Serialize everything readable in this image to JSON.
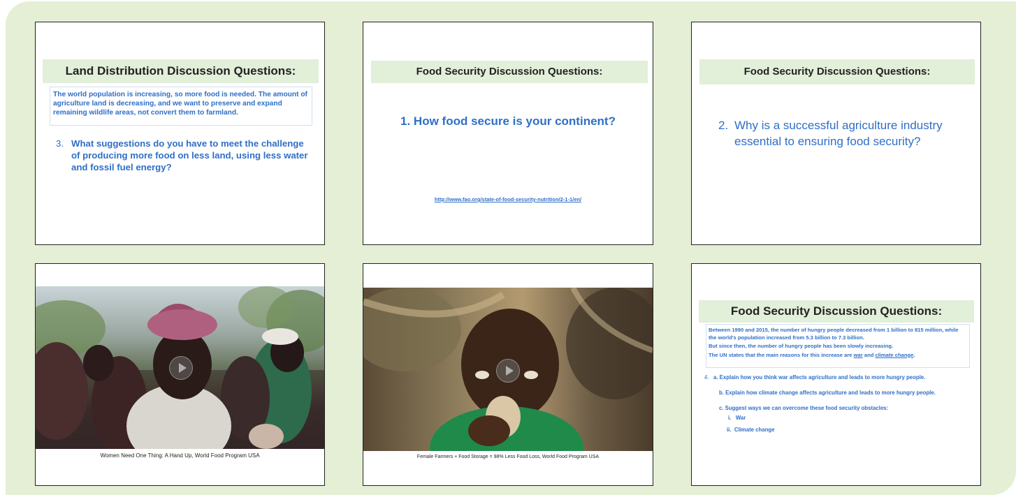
{
  "slides": {
    "s1": {
      "header": "Land Distribution Discussion Questions:",
      "intro": "The world population is increasing, so more food is needed. The amount of agriculture land is decreasing, and we want to preserve and expand remaining wildlife areas, not convert them to farmland.",
      "question_num": "3.",
      "question": "What suggestions do you have to meet the challenge of producing more food on less land, using less water and fossil fuel energy?"
    },
    "s2": {
      "header": "Food Security Discussion Questions:",
      "question": "1. How food secure is your continent?",
      "link": "http://www.fao.org/state-of-food-security-nutrition/2-1-1/en/"
    },
    "s3": {
      "header": "Food Security Discussion Questions:",
      "question_num": "2.",
      "question": "Why is a successful agriculture industry essential to ensuring food security?"
    },
    "s4": {
      "caption": "Women Need One Thing: A Hand Up, World Food Program USA"
    },
    "s5": {
      "caption": "Female Farmers + Food Storage = 98% Less Food Loss, World Food Program USA"
    },
    "s6": {
      "header": "Food Security Discussion Questions:",
      "intro_line1": "Between 1990 and 2015, the number of hungry people decreased from 1 billion to 815 million, while the world's population increased from 5.3 billion to 7.3 billion.",
      "intro_line2": "But since then, the number of hungry people has been slowly increasing.",
      "intro_line3_pre": "The UN states that the main reasons for this increase are ",
      "intro_link_war": "war",
      "intro_and": " and ",
      "intro_link_climate": "climate change",
      "intro_end": ".",
      "q_num": "4.",
      "qa": "a. Explain how you think war affects agriculture and leads to more hungry people.",
      "qb": "b. Explain how climate change affects agriculture and leads to more hungry people.",
      "qc": "c. Suggest ways we can overcome these food security obstacles:",
      "qc_i": "i.   War",
      "qc_ii": "ii.  Climate change"
    }
  },
  "colors": {
    "panel": "#e4efd6",
    "header": "#e2efd9",
    "accent": "#2f6fc7"
  }
}
